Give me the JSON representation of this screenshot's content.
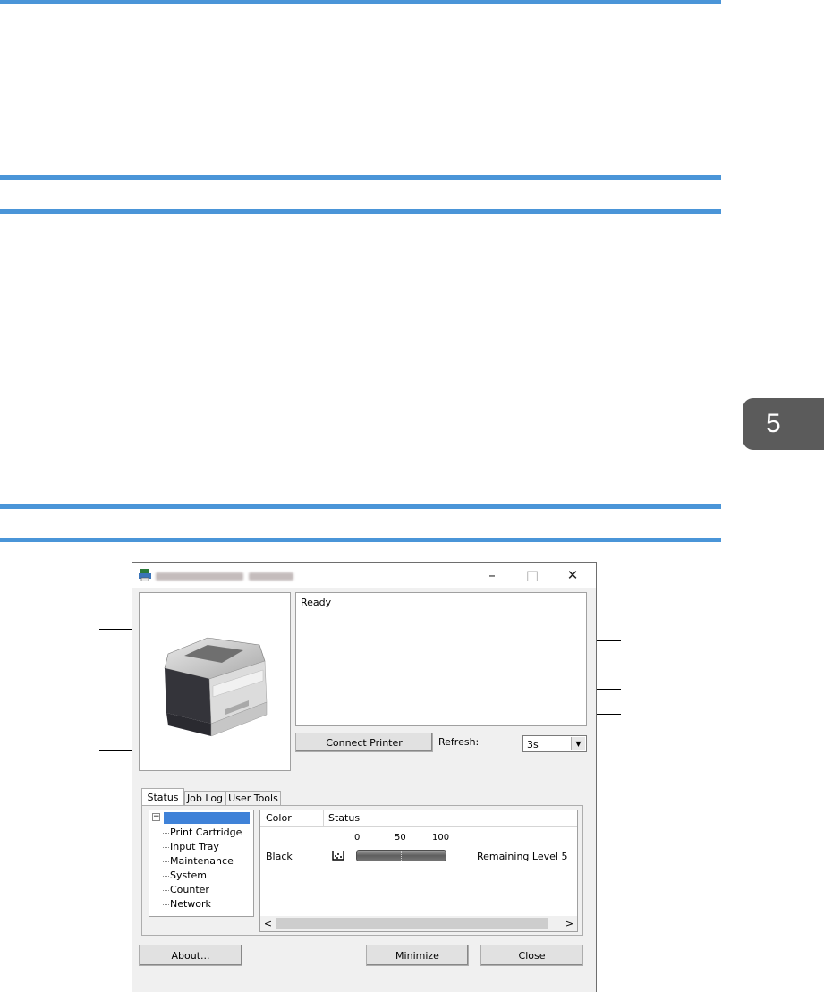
{
  "chapter": {
    "number": "5"
  },
  "dialog": {
    "window_controls": {
      "minimize": "–",
      "maximize": "□",
      "close": "✕"
    },
    "status_message": "Ready",
    "connect_button": "Connect Printer",
    "refresh_label": "Refresh:",
    "refresh_value": "3s",
    "tabs": [
      "Status",
      "Job Log",
      "User Tools"
    ],
    "tree_items": [
      "Print Cartridge",
      "Input Tray",
      "Maintenance",
      "System",
      "Counter",
      "Network"
    ],
    "table": {
      "columns": [
        "Color",
        "Status"
      ],
      "scale": [
        "0",
        "50",
        "100"
      ],
      "rows": [
        {
          "color": "Black",
          "remaining": "Remaining Level 5"
        }
      ]
    },
    "buttons": {
      "about": "About...",
      "minimize": "Minimize",
      "close": "Close"
    }
  }
}
